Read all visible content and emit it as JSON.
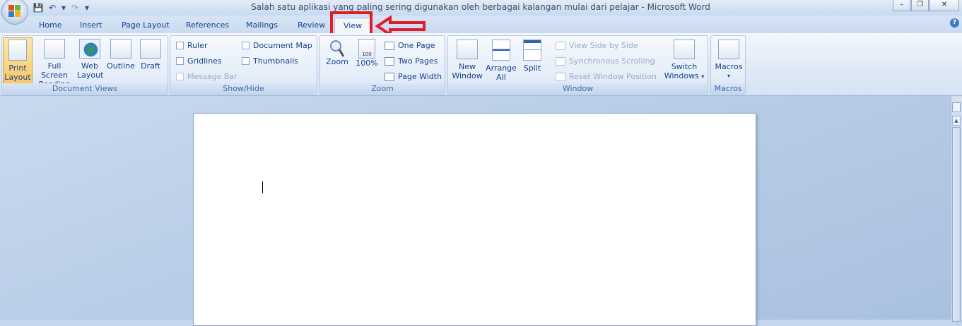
{
  "window": {
    "title": "Salah satu aplikasi yang paling sering digunakan oleh berbagai kalangan mulai dari pelajar - Microsoft Word",
    "controls": {
      "minimize": "–",
      "restore": "❐",
      "close": "✕"
    }
  },
  "quick_access": {
    "save_icon": "💾",
    "undo_icon": "↶",
    "undo_dropdown": "▾",
    "redo_icon": "↷",
    "customize": "▾"
  },
  "tabs": [
    "Home",
    "Insert",
    "Page Layout",
    "References",
    "Mailings",
    "Review",
    "View"
  ],
  "active_tab": "View",
  "help": "?",
  "annotation": {
    "color": "#e21b24"
  },
  "ribbon": {
    "document_views": {
      "label": "Document Views",
      "print_layout": [
        "Print",
        "Layout"
      ],
      "full_screen_reading": [
        "Full Screen",
        "Reading"
      ],
      "web_layout": [
        "Web",
        "Layout"
      ],
      "outline": "Outline",
      "draft": "Draft"
    },
    "show_hide": {
      "label": "Show/Hide",
      "ruler": "Ruler",
      "gridlines": "Gridlines",
      "message_bar": "Message Bar",
      "document_map": "Document Map",
      "thumbnails": "Thumbnails"
    },
    "zoom": {
      "label": "Zoom",
      "zoom": "Zoom",
      "hundred": "100%",
      "hundred_icon_text": "100",
      "one_page": "One Page",
      "two_pages": "Two Pages",
      "page_width": "Page Width"
    },
    "window": {
      "label": "Window",
      "new_window": [
        "New",
        "Window"
      ],
      "arrange_all": [
        "Arrange",
        "All"
      ],
      "split": "Split",
      "view_side_by_side": "View Side by Side",
      "synchronous_scrolling": "Synchronous Scrolling",
      "reset_window_position": "Reset Window Position",
      "switch_windows": [
        "Switch",
        "Windows"
      ]
    },
    "macros": {
      "label": "Macros",
      "macros": "Macros"
    }
  },
  "colors": {
    "accent_text": "#15428b",
    "selected_button": "#f8c863",
    "arrow": "#e21b24"
  }
}
